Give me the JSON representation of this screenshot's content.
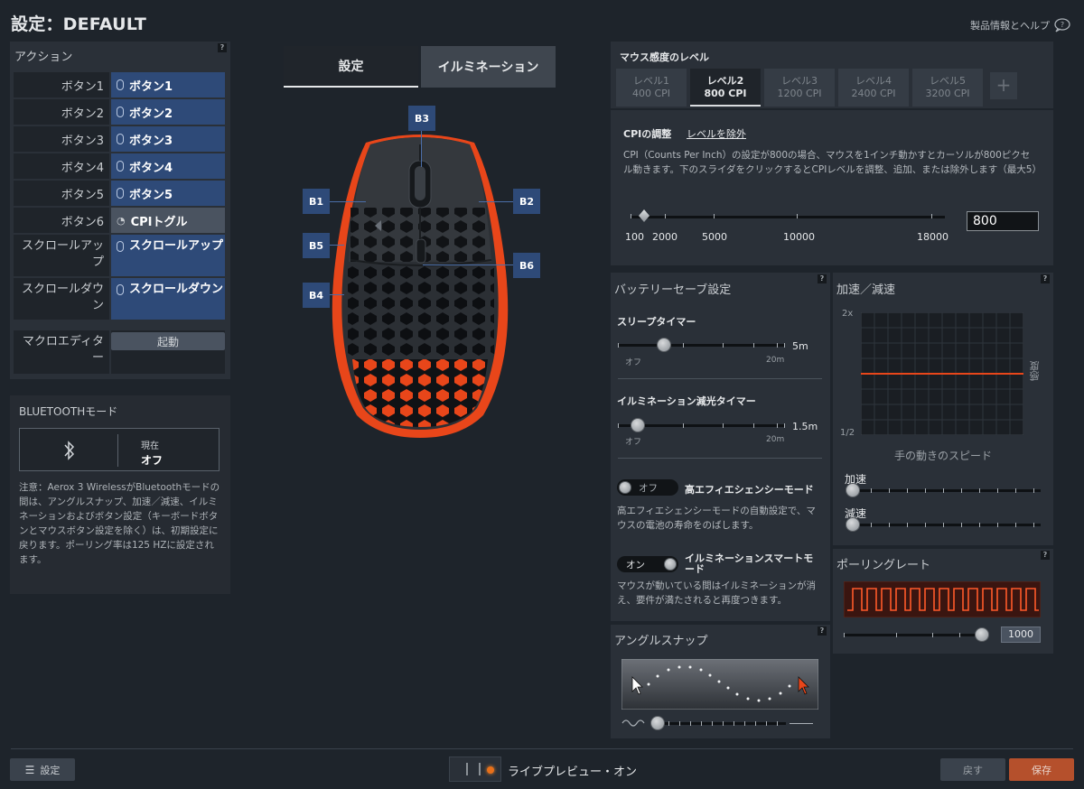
{
  "header": {
    "title": "設定：DEFAULT",
    "help": "製品情報とヘルプ"
  },
  "actions": {
    "title": "アクション",
    "rows": [
      {
        "label": "ボタン1",
        "value": "ボタン1"
      },
      {
        "label": "ボタン2",
        "value": "ボタン2"
      },
      {
        "label": "ボタン3",
        "value": "ボタン3"
      },
      {
        "label": "ボタン4",
        "value": "ボタン4"
      },
      {
        "label": "ボタン5",
        "value": "ボタン5"
      },
      {
        "label": "ボタン6",
        "value": "CPIトグル"
      },
      {
        "label": "スクロールアップ",
        "value": "スクロールアップ"
      },
      {
        "label": "スクロールダウン",
        "value": "スクロールダウン"
      }
    ],
    "macro_label": "マクロエディター",
    "macro_button": "起動",
    "help": "?"
  },
  "bluetooth": {
    "title": "BLUETOOTHモード",
    "current_label": "現在",
    "current_value": "オフ",
    "note": "注意：Aerox 3 WirelessがBluetoothモードの間は、アングルスナップ、加速／減速、イルミネーションおよびボタン設定（キーボードボタンとマウスボタン設定を除く）は、初期設定に戻ります。ポーリング率は125 HZに設定されます。"
  },
  "tabs": {
    "settings": "設定",
    "illumination": "イルミネーション"
  },
  "mouse_buttons": {
    "b1": "B1",
    "b2": "B2",
    "b3": "B3",
    "b4": "B4",
    "b5": "B5",
    "b6": "B6"
  },
  "cpi": {
    "title": "マウス感度のレベル",
    "levels": [
      {
        "name": "レベル1",
        "cpi": "400 CPI"
      },
      {
        "name": "レベル2",
        "cpi": "800 CPI"
      },
      {
        "name": "レベル3",
        "cpi": "1200 CPI"
      },
      {
        "name": "レベル4",
        "cpi": "2400 CPI"
      },
      {
        "name": "レベル5",
        "cpi": "3200 CPI"
      }
    ],
    "add": "+",
    "adjust_label": "CPIの調整",
    "remove_label": "レベルを除外",
    "description": "CPI（Counts Per Inch）の設定が800の場合、マウスを1インチ動かすとカーソルが800ピクセル動きます。下のスライダをクリックするとCPIレベルを調整、追加、または除外します（最大5）",
    "ticks": [
      "100",
      "2000",
      "5000",
      "10000",
      "18000"
    ],
    "value": "800"
  },
  "battery": {
    "title": "バッテリーセーブ設定",
    "sleep_label": "スリープタイマー",
    "sleep_value": "5m",
    "sleep_min": "オフ",
    "sleep_max": "20m",
    "dim_label": "イルミネーション減光タイマー",
    "dim_value": "1.5m",
    "dim_min": "オフ",
    "dim_max": "20m",
    "efficiency_toggle": "オフ",
    "efficiency_label": "高エフィエシェンシーモード",
    "efficiency_desc": "高エフィエシェンシーモードの自動設定で、マウスの電池の寿命をのばします。",
    "smart_toggle": "オン",
    "smart_label": "イルミネーションスマートモード",
    "smart_desc": "マウスが動いている間はイルミネーションが消え、要件が満たされると再度つきます。"
  },
  "accel": {
    "title": "加速／減速",
    "y_top": "2x",
    "y_bottom": "1/2",
    "y_label": "感度",
    "x_label": "手の動きのスピード",
    "accel_label": "加速",
    "decel_label": "減速"
  },
  "polling": {
    "title": "ポーリングレート",
    "value": "1000"
  },
  "angle_snap": {
    "title": "アングルスナップ"
  },
  "footer": {
    "settings": "設定",
    "live_preview": "ライブプレビュー・オン",
    "back": "戻す",
    "save": "保存"
  },
  "colors": {
    "accent_blue": "#2e4a78",
    "accent_orange": "#e8461a",
    "save": "#b5502c"
  }
}
